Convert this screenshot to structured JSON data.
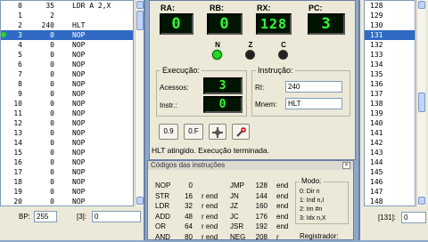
{
  "memory_left": {
    "rows": [
      {
        "addr": "0",
        "val": "35",
        "mnem": "LDR A 2,X"
      },
      {
        "addr": "1",
        "val": "2",
        "mnem": ""
      },
      {
        "addr": "2",
        "val": "240",
        "mnem": "HLT"
      },
      {
        "addr": "3",
        "val": "0",
        "mnem": "NOP"
      },
      {
        "addr": "4",
        "val": "0",
        "mnem": "NOP"
      },
      {
        "addr": "5",
        "val": "0",
        "mnem": "NOP"
      },
      {
        "addr": "6",
        "val": "0",
        "mnem": "NOP"
      },
      {
        "addr": "7",
        "val": "0",
        "mnem": "NOP"
      },
      {
        "addr": "8",
        "val": "0",
        "mnem": "NOP"
      },
      {
        "addr": "9",
        "val": "0",
        "mnem": "NOP"
      },
      {
        "addr": "10",
        "val": "0",
        "mnem": "NOP"
      },
      {
        "addr": "11",
        "val": "0",
        "mnem": "NOP"
      },
      {
        "addr": "12",
        "val": "0",
        "mnem": "NOP"
      },
      {
        "addr": "13",
        "val": "0",
        "mnem": "NOP"
      },
      {
        "addr": "14",
        "val": "0",
        "mnem": "NOP"
      },
      {
        "addr": "15",
        "val": "0",
        "mnem": "NOP"
      },
      {
        "addr": "16",
        "val": "0",
        "mnem": "NOP"
      },
      {
        "addr": "17",
        "val": "0",
        "mnem": "NOP"
      },
      {
        "addr": "18",
        "val": "0",
        "mnem": "NOP"
      },
      {
        "addr": "19",
        "val": "0",
        "mnem": "NOP"
      },
      {
        "addr": "20",
        "val": "0",
        "mnem": "NOP"
      }
    ],
    "bp_label": "BP:",
    "bp_value": "255",
    "addr_label": "[3]:",
    "addr_value": "0"
  },
  "memory_right": {
    "rows": [
      "128",
      "129",
      "130",
      "131",
      "132",
      "133",
      "134",
      "135",
      "136",
      "137",
      "138",
      "139",
      "140",
      "141",
      "142",
      "143",
      "144",
      "145",
      "146",
      "147",
      "148"
    ],
    "addr_label": "[131]:",
    "addr_value": "0"
  },
  "cpu": {
    "ra_label": "RA:",
    "ra_value": "0",
    "rb_label": "RB:",
    "rb_value": "0",
    "rx_label": "RX:",
    "rx_value": "128",
    "pc_label": "PC:",
    "pc_value": "3",
    "flags": [
      {
        "label": "N",
        "state": "on"
      },
      {
        "label": "Z",
        "state": "off"
      },
      {
        "label": "C",
        "state": "off"
      }
    ],
    "exec_title": "Execução:",
    "accesses_label": "Acessos:",
    "accesses_value": "3",
    "instr_count_label": "Instr.:",
    "instr_count_value": "0",
    "instruction_title": "Instrução:",
    "ri_label": "RI:",
    "ri_value": "240",
    "mnem_label": "Mnem:",
    "mnem_value": "HLT",
    "btn_zoom": "0.9",
    "btn_hex": "0.F",
    "status": "HLT atingido. Execução terminada."
  },
  "instructions": {
    "title": "Códigos das instruções",
    "col1": [
      {
        "m": "NOP",
        "c": "0",
        "a": ""
      },
      {
        "m": "STR",
        "c": "16",
        "a": "r end"
      },
      {
        "m": "LDR",
        "c": "32",
        "a": "r end"
      },
      {
        "m": "ADD",
        "c": "48",
        "a": "r end"
      },
      {
        "m": "OR",
        "c": "64",
        "a": "r end"
      },
      {
        "m": "AND",
        "c": "80",
        "a": "r end"
      }
    ],
    "col2": [
      {
        "m": "JMP",
        "c": "128",
        "a": "end"
      },
      {
        "m": "JN",
        "c": "144",
        "a": "end"
      },
      {
        "m": "JZ",
        "c": "160",
        "a": "end"
      },
      {
        "m": "JC",
        "c": "176",
        "a": "end"
      },
      {
        "m": "JSR",
        "c": "192",
        "a": "end"
      },
      {
        "m": "NEG",
        "c": "208",
        "a": "r"
      }
    ],
    "modes_title": "Modo:",
    "modes": [
      "0: Dir   n",
      "1: Ind   n,I",
      "2: Im   #n",
      "3: Idx   n,X"
    ],
    "reg_title": "Registrador:"
  },
  "colors": {
    "lcd_fg": "#32ff32",
    "select": "#316ac5"
  }
}
